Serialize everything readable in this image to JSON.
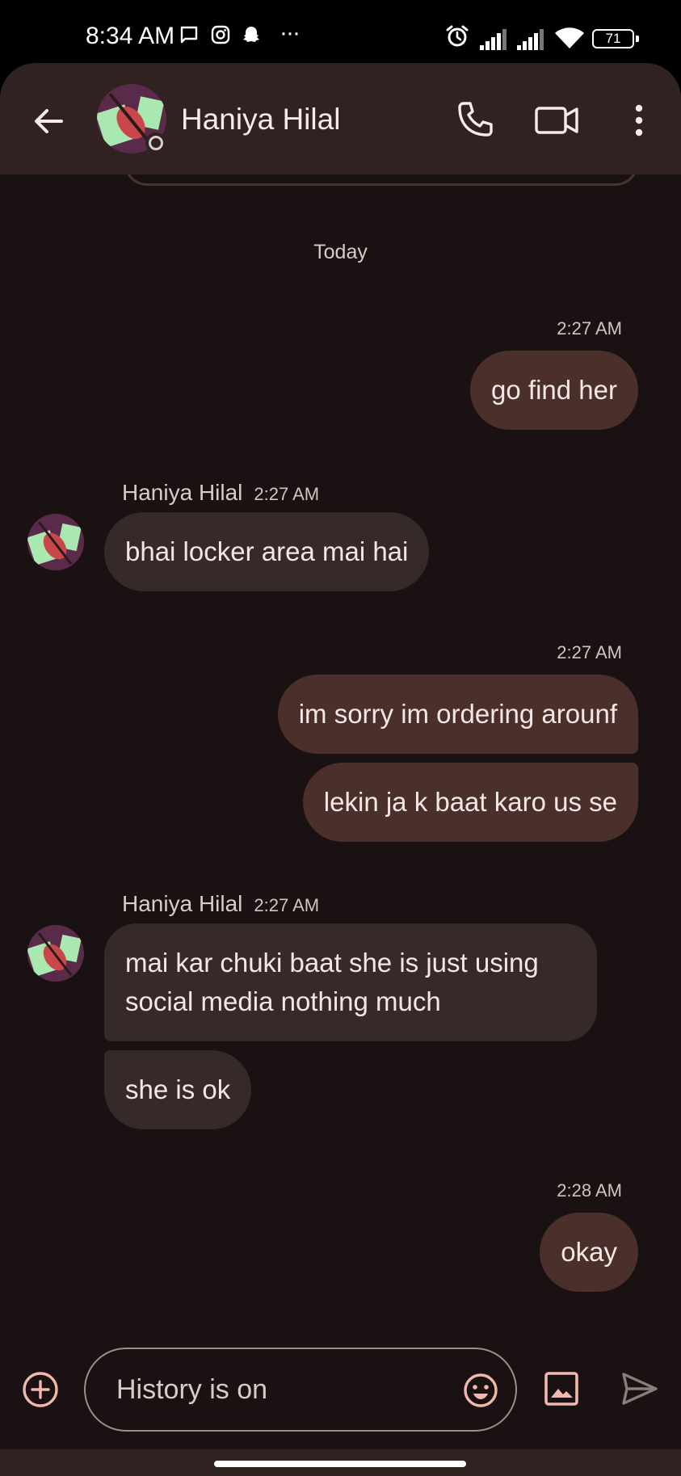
{
  "status_bar": {
    "time": "8:34 AM",
    "more": "···",
    "battery": "71",
    "icons": [
      "message-icon",
      "instagram-icon",
      "snapchat-icon",
      "alarm-icon",
      "signal-icon",
      "signal-icon",
      "wifi-icon",
      "battery-icon"
    ]
  },
  "header": {
    "contact_name": "Haniya Hilal",
    "icons": [
      "back-arrow-icon",
      "phone-icon",
      "video-call-icon",
      "more-vert-icon"
    ]
  },
  "conversation": {
    "date_divider": "Today",
    "groups": [
      {
        "direction": "outgoing",
        "time": "2:27 AM",
        "messages": [
          "go find her"
        ]
      },
      {
        "direction": "incoming",
        "sender": "Haniya Hilal",
        "time": "2:27 AM",
        "messages": [
          "bhai locker area mai hai"
        ]
      },
      {
        "direction": "outgoing",
        "time": "2:27 AM",
        "messages": [
          "im sorry im ordering arounf",
          "lekin ja k baat karo us se"
        ]
      },
      {
        "direction": "incoming",
        "sender": "Haniya Hilal",
        "time": "2:27 AM",
        "messages": [
          "mai kar chuki baat she is just using social media nothing much",
          "she is ok"
        ]
      },
      {
        "direction": "outgoing",
        "time": "2:28 AM",
        "messages": [
          "okay"
        ]
      }
    ]
  },
  "compose": {
    "placeholder": "History is on",
    "icons": [
      "add-circle-icon",
      "emoji-icon",
      "gallery-icon",
      "send-icon"
    ]
  },
  "colors": {
    "background": "#1a1212",
    "header": "#302220",
    "outgoing_bubble": "#4a2f2b",
    "incoming_bubble": "#352a29",
    "accent": "#f2b8ad"
  }
}
